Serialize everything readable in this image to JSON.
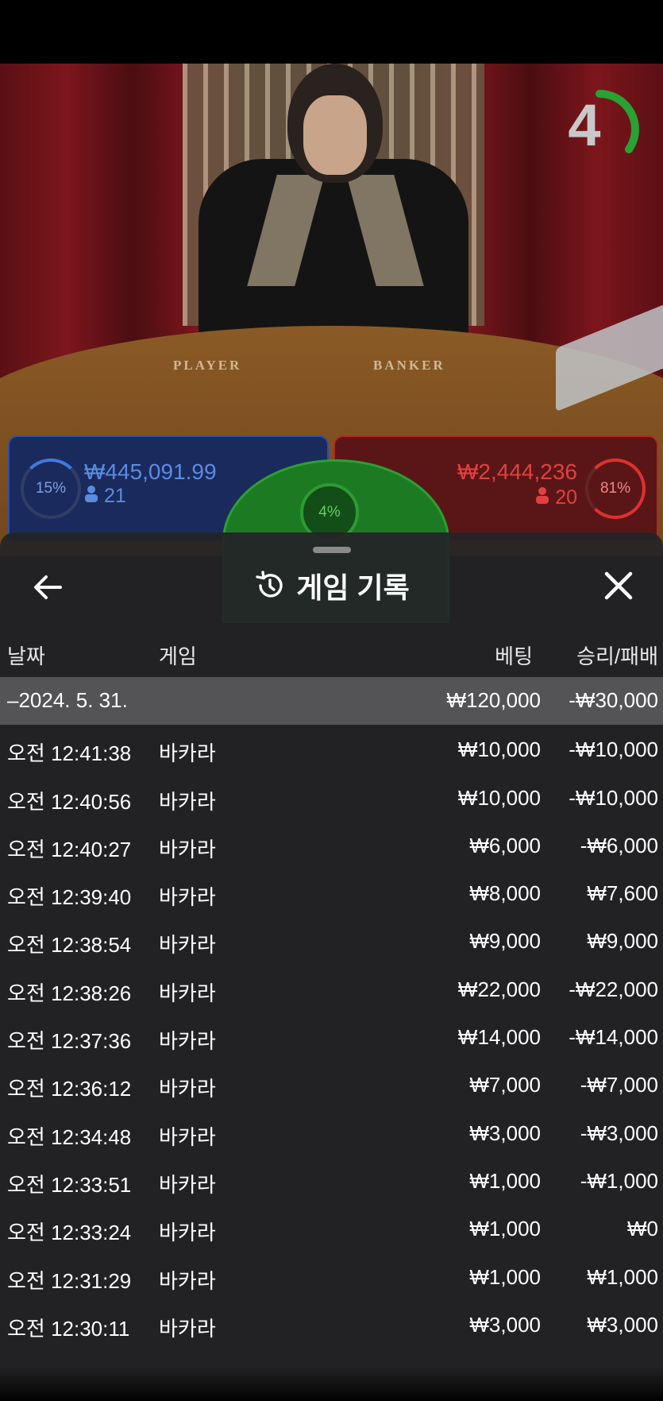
{
  "timer": {
    "value": "4"
  },
  "betting": {
    "player": {
      "percent": "15%",
      "amount": "₩445,091.99",
      "count": "21"
    },
    "tie": {
      "percent": "4%"
    },
    "banker": {
      "percent": "81%",
      "amount": "₩2,444,236",
      "count": "20"
    }
  },
  "table_labels": {
    "player": "PLAYER",
    "banker": "BANKER"
  },
  "sheet": {
    "title": "게임 기록",
    "columns": {
      "date": "날짜",
      "game": "게임",
      "bet": "베팅",
      "result": "승리/패배"
    },
    "summary": {
      "date": "–2024. 5. 31.",
      "bet": "₩120,000",
      "result": "-₩30,000"
    },
    "rows": [
      {
        "date": "오전 12:41:38",
        "game": "바카라",
        "bet": "₩10,000",
        "result": "-₩10,000"
      },
      {
        "date": "오전 12:40:56",
        "game": "바카라",
        "bet": "₩10,000",
        "result": "-₩10,000"
      },
      {
        "date": "오전 12:40:27",
        "game": "바카라",
        "bet": "₩6,000",
        "result": "-₩6,000"
      },
      {
        "date": "오전 12:39:40",
        "game": "바카라",
        "bet": "₩8,000",
        "result": "₩7,600"
      },
      {
        "date": "오전 12:38:54",
        "game": "바카라",
        "bet": "₩9,000",
        "result": "₩9,000"
      },
      {
        "date": "오전 12:38:26",
        "game": "바카라",
        "bet": "₩22,000",
        "result": "-₩22,000"
      },
      {
        "date": "오전 12:37:36",
        "game": "바카라",
        "bet": "₩14,000",
        "result": "-₩14,000"
      },
      {
        "date": "오전 12:36:12",
        "game": "바카라",
        "bet": "₩7,000",
        "result": "-₩7,000"
      },
      {
        "date": "오전 12:34:48",
        "game": "바카라",
        "bet": "₩3,000",
        "result": "-₩3,000"
      },
      {
        "date": "오전 12:33:51",
        "game": "바카라",
        "bet": "₩1,000",
        "result": "-₩1,000"
      },
      {
        "date": "오전 12:33:24",
        "game": "바카라",
        "bet": "₩1,000",
        "result": "₩0"
      },
      {
        "date": "오전 12:31:29",
        "game": "바카라",
        "bet": "₩1,000",
        "result": "₩1,000"
      },
      {
        "date": "오전 12:30:11",
        "game": "바카라",
        "bet": "₩3,000",
        "result": "₩3,000"
      }
    ]
  },
  "icons": {
    "back": "arrow-left-icon",
    "history": "history-icon",
    "close": "close-icon",
    "person": "person-icon"
  }
}
